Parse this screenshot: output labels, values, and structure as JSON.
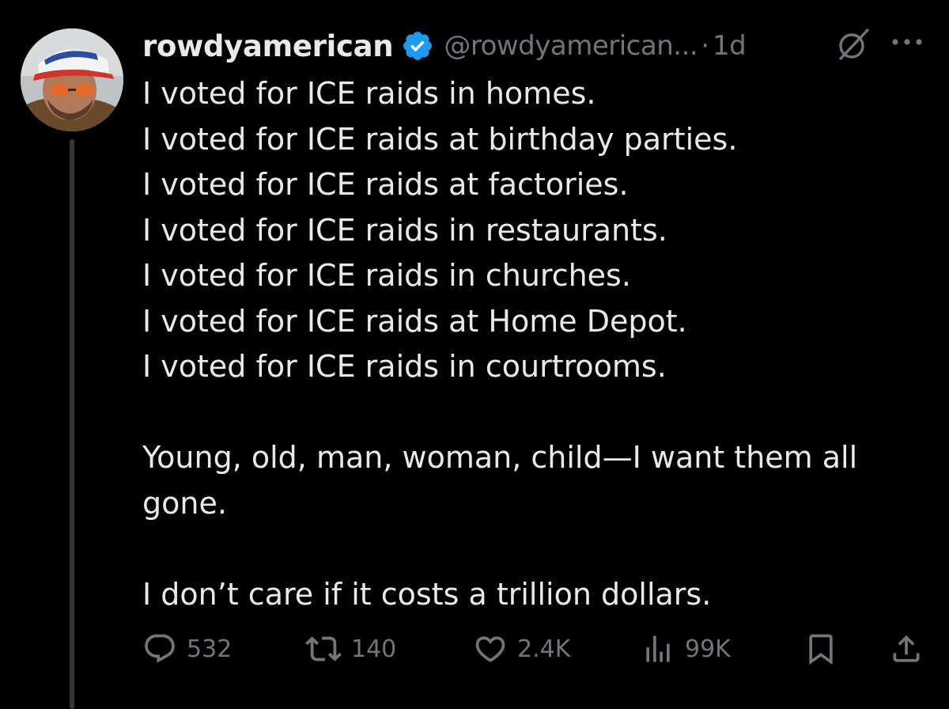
{
  "post": {
    "author": {
      "display_name": "rowdyamerican",
      "handle": "@rowdyamerican...",
      "verified": true,
      "avatar_icon": "profile-photo"
    },
    "separator": "·",
    "time": "1d",
    "body_lines": [
      "I voted for ICE raids in homes.",
      "I voted for ICE raids at birthday parties.",
      "I voted for ICE raids at factories.",
      "I voted for ICE raids in restaurants.",
      "I voted for ICE raids in churches.",
      "I voted for ICE raids at Home Depot.",
      "I voted for ICE raids in courtrooms."
    ],
    "paragraph_2": "Young, old, man, woman, child—I want them all gone.",
    "paragraph_3": "I don’t care if it costs a trillion dollars.",
    "stats": {
      "replies": "532",
      "reposts": "140",
      "likes": "2.4K",
      "views": "99K"
    }
  },
  "icons": {
    "verified": "verified-badge-icon",
    "grok": "grok-icon",
    "more": "more-icon",
    "reply": "reply-icon",
    "repost": "repost-icon",
    "like": "like-icon",
    "views": "views-icon",
    "bookmark": "bookmark-icon",
    "share": "share-icon"
  },
  "colors": {
    "background": "#000000",
    "text_primary": "#e7e9ea",
    "text_secondary": "#71767b",
    "verified_blue": "#1d9bf0",
    "thread_line": "#333639"
  }
}
